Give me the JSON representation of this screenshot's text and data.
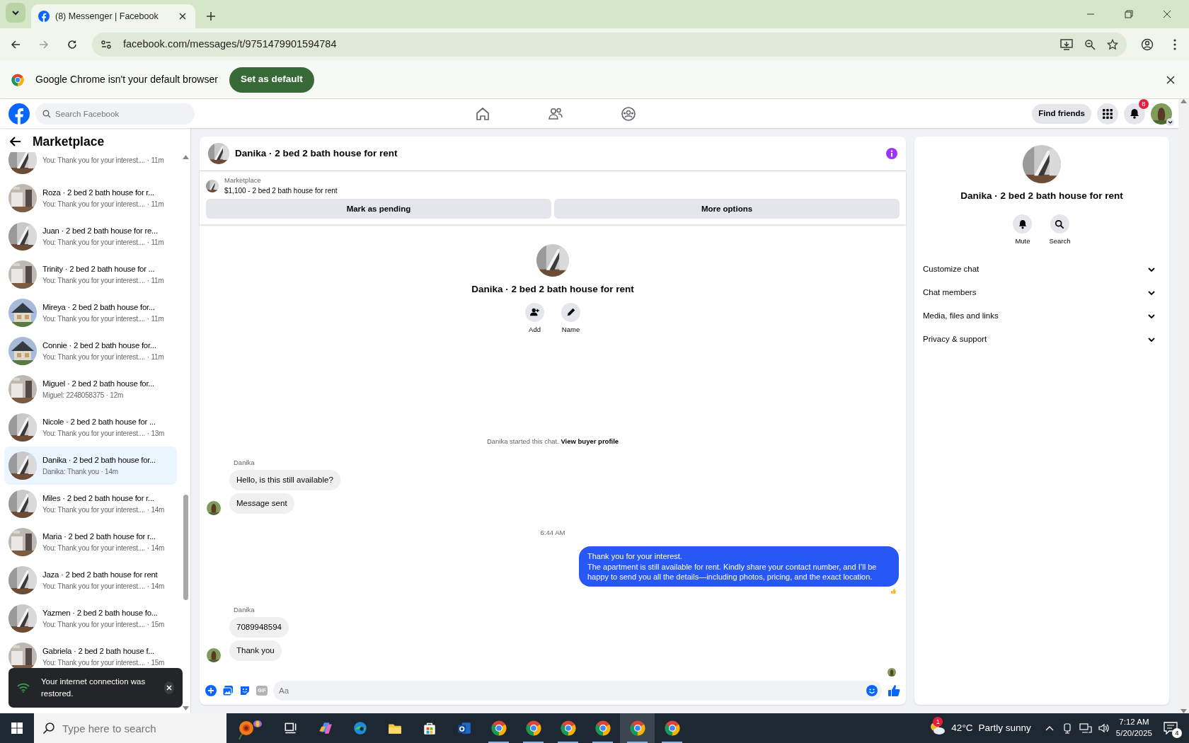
{
  "browser": {
    "tab_title": "(8) Messenger | Facebook",
    "url": "facebook.com/messages/t/9751479901594784",
    "infobar": {
      "text": "Google Chrome isn't your default browser",
      "button": "Set as default"
    }
  },
  "facebook": {
    "search_placeholder": "Search Facebook",
    "find_friends": "Find friends",
    "notifications": "8"
  },
  "sidebar": {
    "title": "Marketplace",
    "conversations": [
      {
        "preview": "You: Thank you for your interest.... · 11m",
        "selected": false
      },
      {
        "title": "Roza · 2 bed 2 bath house for r...",
        "preview": "You: Thank you for your interest.... · 11m",
        "selected": false
      },
      {
        "title": "Juan · 2 bed 2 bath house for re...",
        "preview": "You: Thank you for your interest.... · 11m",
        "selected": false
      },
      {
        "title": "Trinity · 2 bed 2 bath house for ...",
        "preview": "You: Thank you for your interest.... · 11m",
        "selected": false
      },
      {
        "title": "Mireya · 2 bed 2 bath house for...",
        "preview": "You: Thank you for your interest.... · 11m",
        "selected": false
      },
      {
        "title": "Connie · 2 bed 2 bath house for...",
        "preview": "You: Thank you for your interest.... · 11m",
        "selected": false
      },
      {
        "title": "Miguel · 2 bed 2 bath house for...",
        "preview": "Miguel: 2248058375 · 12m",
        "selected": false
      },
      {
        "title": "Nicole · 2 bed 2 bath house for ...",
        "preview": "You: Thank you for your interest.... · 13m",
        "selected": false
      },
      {
        "title": "Danika · 2 bed 2 bath house for...",
        "preview": "Danika: Thank you · 14m",
        "selected": true
      },
      {
        "title": "Miles · 2 bed 2 bath house for r...",
        "preview": "You: Thank you for your interest.... · 14m",
        "selected": false
      },
      {
        "title": "Maria · 2 bed 2 bath house for r...",
        "preview": "You: Thank you for your interest.... · 14m",
        "selected": false
      },
      {
        "title": "Jaza · 2 bed 2 bath house for rent",
        "preview": "You: Thank you for your interest.... · 14m",
        "selected": false
      },
      {
        "title": "Yazmen · 2 bed 2 bath house fo...",
        "preview": "You: Thank you for your interest.... · 15m",
        "selected": false
      },
      {
        "title": "Gabriela · 2 bed 2 bath house f...",
        "preview": "You: Thank you for your interest.... · 15m",
        "selected": false
      }
    ]
  },
  "toast": {
    "text": "Your internet connection was restored."
  },
  "chat": {
    "title": "Danika · 2 bed 2 bath house for rent",
    "listing": {
      "source": "Marketplace",
      "summary": "$1,100 - 2 bed 2 bath house for rent"
    },
    "actions": [
      "Mark as pending",
      "More options"
    ],
    "profile": {
      "name": "Danika · 2 bed 2 bath house for rent",
      "buttons": [
        {
          "kind": "add",
          "label": "Add"
        },
        {
          "kind": "edit",
          "label": "Name"
        }
      ]
    },
    "started": {
      "text": "Danika started this chat.",
      "link": "View buyer profile"
    },
    "messages": [
      {
        "kind": "sender",
        "text": "Danika"
      },
      {
        "kind": "incoming",
        "text": "Hello, is this still available?",
        "avatar": false
      },
      {
        "kind": "incoming",
        "text": "Message sent",
        "avatar": true
      },
      {
        "kind": "time",
        "text": "6:44 AM"
      },
      {
        "kind": "outgoing",
        "lines": [
          "Thank you for your interest.",
          "The apartment is still available for rent. Kindly share your contact number, and I’ll be happy to send you all the details—including photos, pricing, and the exact location."
        ],
        "reacted": true
      },
      {
        "kind": "sender",
        "text": "Danika"
      },
      {
        "kind": "incoming",
        "text": "7089948594",
        "avatar": false
      },
      {
        "kind": "incoming",
        "text": "Thank you",
        "avatar": true
      },
      {
        "kind": "seen"
      }
    ],
    "composer": {
      "gif_label": "GIF",
      "placeholder": "Aa"
    }
  },
  "details": {
    "name": "Danika · 2 bed 2 bath house for rent",
    "buttons": [
      {
        "kind": "mute",
        "label": "Mute"
      },
      {
        "kind": "search",
        "label": "Search"
      }
    ],
    "sections": [
      {
        "label": "Customize chat",
        "expanded": false
      },
      {
        "label": "Chat members",
        "expanded": false
      },
      {
        "label": "Media, files and links",
        "expanded": false
      },
      {
        "label": "Privacy & support",
        "expanded": false
      }
    ]
  },
  "taskbar": {
    "search_placeholder": "Type here to search",
    "apps": [
      {
        "kind": "taskview",
        "running": false,
        "selected": false
      },
      {
        "kind": "copilot",
        "running": false,
        "selected": false
      },
      {
        "kind": "edge",
        "running": false,
        "selected": false
      },
      {
        "kind": "explorer",
        "running": false,
        "selected": false
      },
      {
        "kind": "store",
        "running": false,
        "selected": false
      },
      {
        "kind": "outlook",
        "running": false,
        "selected": false
      },
      {
        "kind": "chrome",
        "running": true,
        "selected": false
      },
      {
        "kind": "chrome",
        "running": true,
        "selected": false
      },
      {
        "kind": "chrome",
        "running": true,
        "selected": false
      },
      {
        "kind": "chrome",
        "running": true,
        "selected": false
      },
      {
        "kind": "chrome",
        "running": true,
        "selected": true
      },
      {
        "kind": "chrome",
        "running": true,
        "selected": false
      }
    ],
    "weather": {
      "badge": "1",
      "temperature": "42°C",
      "condition": "Partly sunny"
    },
    "clock": {
      "time": "7:12 AM",
      "date": "5/20/2025"
    },
    "notifications": "4"
  }
}
